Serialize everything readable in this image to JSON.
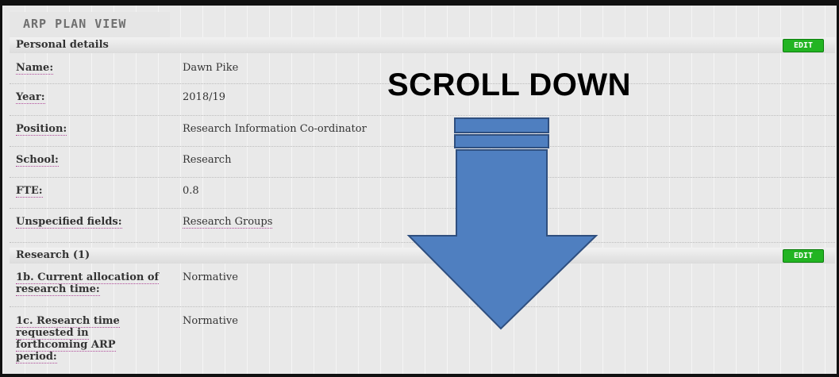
{
  "app": {
    "title": "ARP PLAN VIEW"
  },
  "sections": {
    "personal": {
      "title": "Personal details",
      "edit_label": "EDIT"
    },
    "research": {
      "title": "Research (1)",
      "edit_label": "EDIT"
    }
  },
  "personal_rows": [
    {
      "label": "Name:",
      "value": "Dawn Pike"
    },
    {
      "label": "Year:",
      "value": "2018/19"
    },
    {
      "label": "Position:",
      "value": "Research Information Co-ordinator"
    },
    {
      "label": "School:",
      "value": "Research"
    },
    {
      "label": "FTE:",
      "value": "0.8"
    },
    {
      "label": "Unspecified fields:",
      "value": "Research Groups"
    }
  ],
  "research_rows": [
    {
      "label_lines": [
        "1b. Current allocation of",
        "research time:"
      ],
      "value": "Normative"
    },
    {
      "label_lines": [
        "1c. Research time",
        "requested in",
        "forthcoming ARP",
        "period:"
      ],
      "value": "Normative"
    }
  ],
  "overlay": {
    "text": "SCROLL DOWN",
    "arrow_color": "#4f7fc0",
    "arrow_outline": "#2f4f7f"
  }
}
